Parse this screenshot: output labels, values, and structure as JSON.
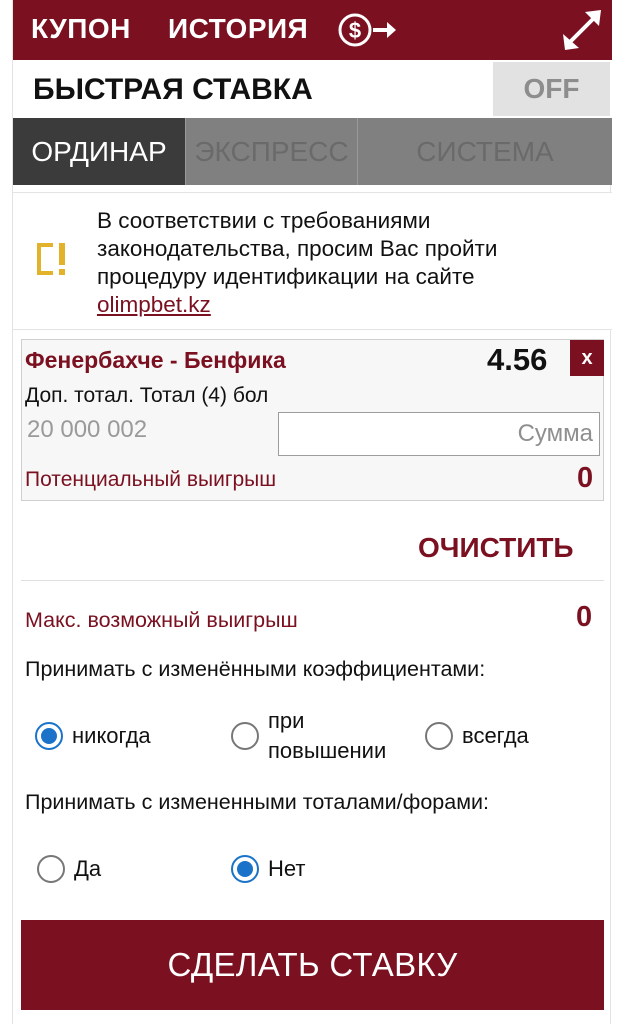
{
  "header": {
    "coupon_label": "КУПОН",
    "history_label": "ИСТОРИЯ",
    "cashout_icon": "cashout-icon",
    "expand_icon": "expand-icon"
  },
  "quick_bet": {
    "title": "БЫСТРАЯ СТАВКА",
    "toggle": "OFF"
  },
  "tabs": [
    {
      "label": "ОРДИНАР",
      "active": true
    },
    {
      "label": "ЭКСПРЕСС",
      "active": false
    },
    {
      "label": "СИСТЕМА",
      "active": false
    }
  ],
  "notice": {
    "icon": "warning-icon",
    "text": "В соответствии с требованиями законодательства, просим Вас пройти процедуру идентификации на сайте",
    "link": "olimpbet.kz"
  },
  "bet": {
    "match": "Фенербахче - Бенфика",
    "odds": "4.56",
    "remove": "x",
    "market": "Доп. тотал. Тотал (4) бол",
    "limit": "20 000 002",
    "amount_placeholder": "Сумма",
    "potential_label": "Потенциальный выигрыш",
    "potential_value": "0"
  },
  "clear_label": "ОЧИСТИТЬ",
  "max_win": {
    "label": "Макс. возможный выигрыш",
    "value": "0"
  },
  "accept_odds": {
    "question": "Принимать с изменёнными коэффициентами:",
    "options": [
      "никогда",
      "при повышении",
      "всегда"
    ],
    "selected": "никогда"
  },
  "accept_totals": {
    "question": "Принимать с измененными тоталами/форами:",
    "options": [
      "Да",
      "Нет"
    ],
    "selected": "Нет"
  },
  "place_bet_label": "СДЕЛАТЬ СТАВКУ",
  "colors": {
    "brand": "#7a1020",
    "radio_selected": "#1a73c8"
  }
}
